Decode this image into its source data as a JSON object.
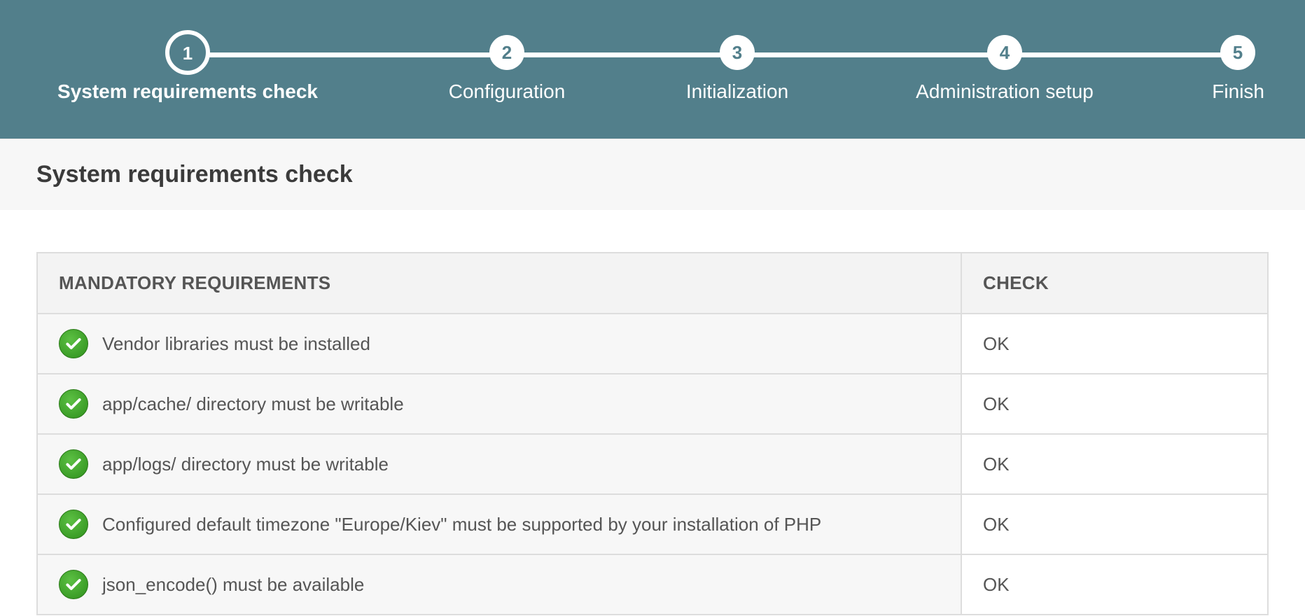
{
  "stepper": {
    "steps": [
      {
        "number": "1",
        "label": "System requirements check",
        "active": true
      },
      {
        "number": "2",
        "label": "Configuration",
        "active": false
      },
      {
        "number": "3",
        "label": "Initialization",
        "active": false
      },
      {
        "number": "4",
        "label": "Administration setup",
        "active": false
      },
      {
        "number": "5",
        "label": "Finish",
        "active": false
      }
    ]
  },
  "page": {
    "title": "System requirements check"
  },
  "table": {
    "headers": {
      "requirement": "MANDATORY REQUIREMENTS",
      "check": "CHECK"
    },
    "rows": [
      {
        "icon": "check-circle-icon",
        "requirement": "Vendor libraries must be installed",
        "check": "OK"
      },
      {
        "icon": "check-circle-icon",
        "requirement": "app/cache/ directory must be writable",
        "check": "OK"
      },
      {
        "icon": "check-circle-icon",
        "requirement": "app/logs/ directory must be writable",
        "check": "OK"
      },
      {
        "icon": "check-circle-icon",
        "requirement": "Configured default timezone \"Europe/Kiev\" must be supported by your installation of PHP",
        "check": "OK"
      },
      {
        "icon": "check-circle-icon",
        "requirement": "json_encode() must be available",
        "check": "OK"
      }
    ]
  },
  "colors": {
    "header_bg": "#527f8b",
    "ok_green": "#3aa52a"
  }
}
